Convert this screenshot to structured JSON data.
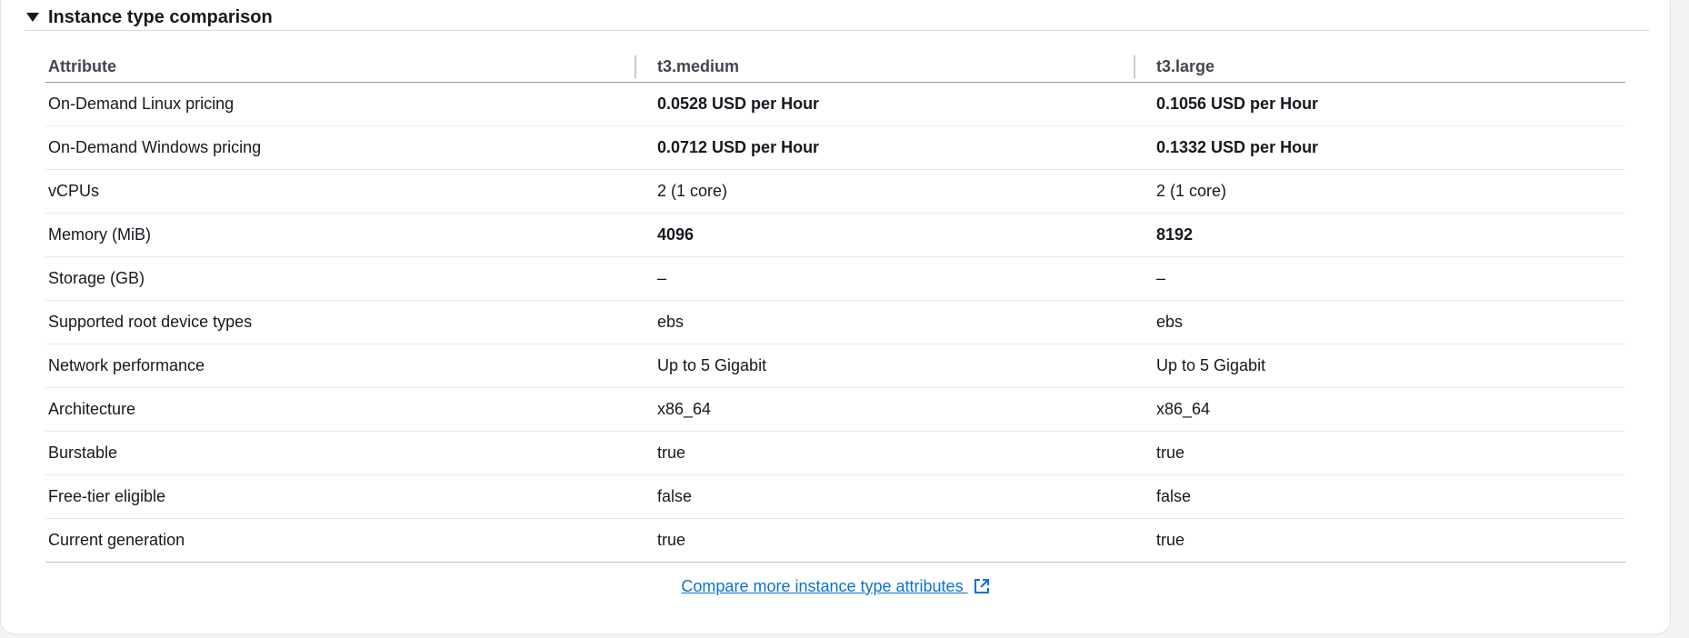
{
  "section": {
    "title": "Instance type comparison"
  },
  "table": {
    "headers": [
      "Attribute",
      "t3.medium",
      "t3.large"
    ],
    "rows": [
      {
        "attr": "On-Demand Linux pricing",
        "a": "0.0528 USD per Hour",
        "b": "0.1056 USD per Hour",
        "bold": true
      },
      {
        "attr": "On-Demand Windows pricing",
        "a": "0.0712 USD per Hour",
        "b": "0.1332 USD per Hour",
        "bold": true
      },
      {
        "attr": "vCPUs",
        "a": "2 (1 core)",
        "b": "2 (1 core)",
        "bold": false
      },
      {
        "attr": "Memory (MiB)",
        "a": "4096",
        "b": "8192",
        "bold": true
      },
      {
        "attr": "Storage (GB)",
        "a": "–",
        "b": "–",
        "bold": false
      },
      {
        "attr": "Supported root device types",
        "a": "ebs",
        "b": "ebs",
        "bold": false
      },
      {
        "attr": "Network performance",
        "a": "Up to 5 Gigabit",
        "b": "Up to 5 Gigabit",
        "bold": false
      },
      {
        "attr": "Architecture",
        "a": "x86_64",
        "b": "x86_64",
        "bold": false
      },
      {
        "attr": "Burstable",
        "a": "true",
        "b": "true",
        "bold": false
      },
      {
        "attr": "Free-tier eligible",
        "a": "false",
        "b": "false",
        "bold": false
      },
      {
        "attr": "Current generation",
        "a": "true",
        "b": "true",
        "bold": false
      }
    ]
  },
  "footer": {
    "link_label": "Compare more instance type attributes ",
    "icon": "external-link-icon"
  },
  "colors": {
    "link": "#0972d3",
    "text": "#16191f",
    "header_text": "#414750"
  }
}
